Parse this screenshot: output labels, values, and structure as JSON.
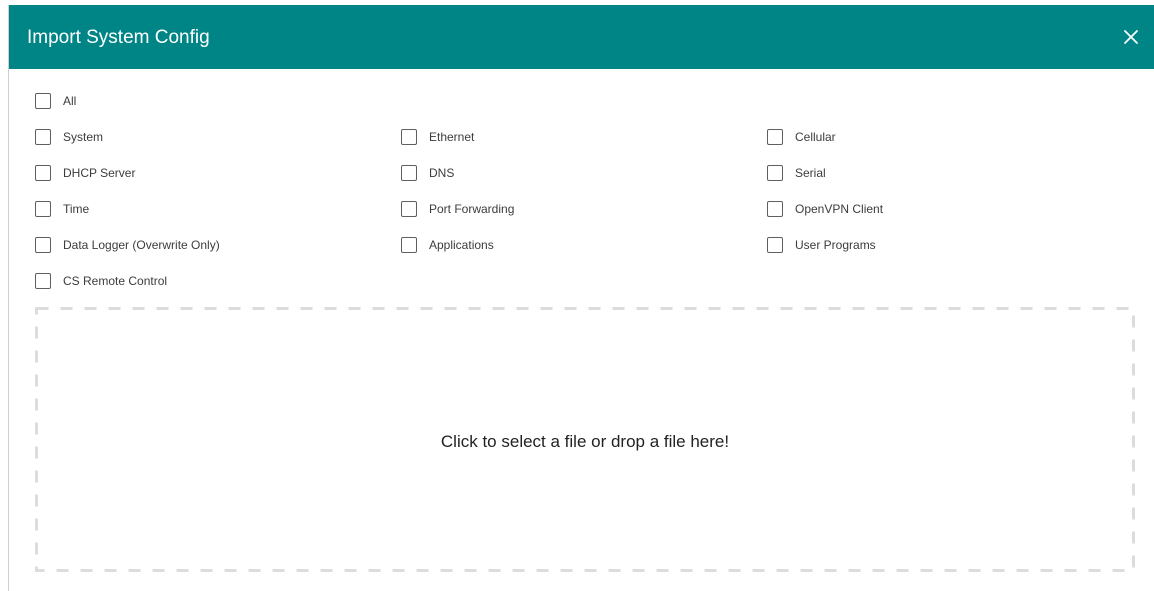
{
  "dialog": {
    "title": "Import System Config",
    "header_color": "#008587",
    "close_icon": "close-icon"
  },
  "options": {
    "all": {
      "label": "All",
      "checked": false
    },
    "system": {
      "label": "System",
      "checked": false
    },
    "ethernet": {
      "label": "Ethernet",
      "checked": false
    },
    "cellular": {
      "label": "Cellular",
      "checked": false
    },
    "dhcp_server": {
      "label": "DHCP Server",
      "checked": false
    },
    "dns": {
      "label": "DNS",
      "checked": false
    },
    "serial": {
      "label": "Serial",
      "checked": false
    },
    "time": {
      "label": "Time",
      "checked": false
    },
    "port_forwarding": {
      "label": "Port Forwarding",
      "checked": false
    },
    "openvpn_client": {
      "label": "OpenVPN Client",
      "checked": false
    },
    "data_logger": {
      "label": "Data Logger (Overwrite Only)",
      "checked": false
    },
    "applications": {
      "label": "Applications",
      "checked": false
    },
    "user_programs": {
      "label": "User Programs",
      "checked": false
    },
    "cs_remote_control": {
      "label": "CS Remote Control",
      "checked": false
    }
  },
  "dropzone": {
    "text": "Click to select a file or drop a file here!"
  }
}
